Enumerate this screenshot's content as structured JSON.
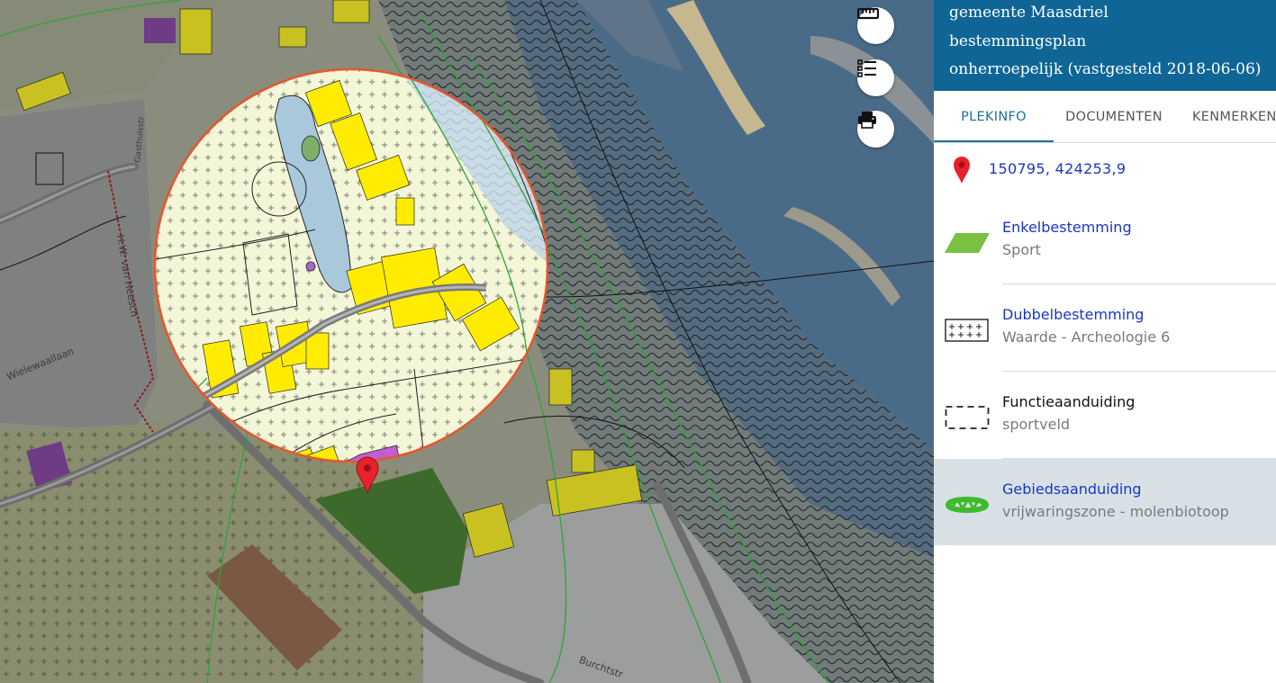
{
  "header": {
    "line1": "gemeente Maasdriel",
    "line2": "bestemmingsplan",
    "line3": "onherroepelijk (vastgesteld 2018-06-06)"
  },
  "tabs": [
    {
      "label": "PLEKINFO",
      "active": true
    },
    {
      "label": "DOCUMENTEN",
      "active": false
    },
    {
      "label": "KENMERKEN",
      "active": false
    }
  ],
  "location": {
    "coordinates": "150795, 424253,9",
    "icon": "map-pin-icon"
  },
  "legend": [
    {
      "title": "Enkelbestemming",
      "subtitle": "Sport",
      "title_is_link": true,
      "icon": "green-parallelogram-icon"
    },
    {
      "title": "Dubbelbestemming",
      "subtitle": "Waarde - Archeologie 6",
      "title_is_link": true,
      "icon": "plus-pattern-icon"
    },
    {
      "title": "Functieaanduiding",
      "subtitle": "sportveld",
      "title_is_link": false,
      "icon": "dashed-rectangle-icon"
    },
    {
      "title": "Gebiedsaanduiding",
      "subtitle": "vrijwaringszone - molenbiotoop",
      "title_is_link": true,
      "icon": "green-zigzag-icon",
      "highlighted": true
    }
  ],
  "map_tools": [
    {
      "name": "measure",
      "icon": "ruler-icon"
    },
    {
      "name": "legend",
      "icon": "list-icon"
    },
    {
      "name": "print",
      "icon": "printer-icon"
    }
  ],
  "street_labels": [
    "Wielewaallaan",
    "H.W. van Heesch",
    "Burchtstr",
    "Gasthuisstr"
  ],
  "colors": {
    "header_bg": "#0f6696",
    "link": "#1a35c8",
    "active_tab": "#1f6f98",
    "highlight_row": "#d8e0e6",
    "circle": "#e8552a",
    "sport_green": "#7ac143"
  }
}
